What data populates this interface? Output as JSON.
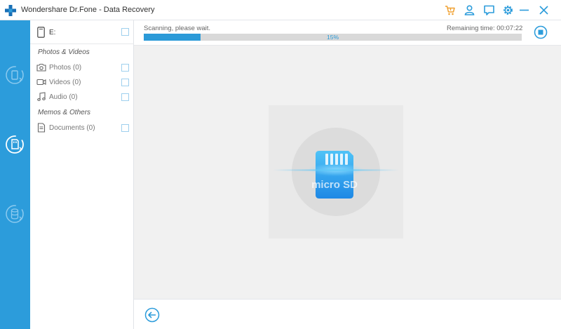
{
  "window": {
    "title": "Wondershare Dr.Fone - Data Recovery",
    "accent_color": "#2c9cdb",
    "cart_color": "#f0a030",
    "icons": [
      "plus-logo-icon",
      "cart-icon",
      "user-icon",
      "feedback-icon",
      "settings-icon",
      "minimize-icon",
      "close-icon"
    ]
  },
  "rail": {
    "items": [
      {
        "name": "phone-recovery-icon"
      },
      {
        "name": "sd-card-recovery-icon",
        "active": true
      },
      {
        "name": "backup-recovery-icon"
      }
    ]
  },
  "sidebar": {
    "drive": {
      "label": "E:"
    },
    "groups": [
      {
        "title": "Photos & Videos",
        "items": [
          {
            "label": "Photos (0)",
            "icon": "camera-icon"
          },
          {
            "label": "Videos (0)",
            "icon": "video-icon"
          },
          {
            "label": "Audio (0)",
            "icon": "music-note-icon"
          }
        ]
      },
      {
        "title": "Memos & Others",
        "items": [
          {
            "label": "Documents (0)",
            "icon": "document-icon"
          }
        ]
      }
    ]
  },
  "scan": {
    "status": "Scanning, please wait.",
    "remaining": "Remaining time: 00:07:22",
    "progress": 0.15,
    "progress_label": "15%",
    "card_text": "micro SD"
  },
  "footer": {
    "back_icon": "back-arrow-icon"
  }
}
